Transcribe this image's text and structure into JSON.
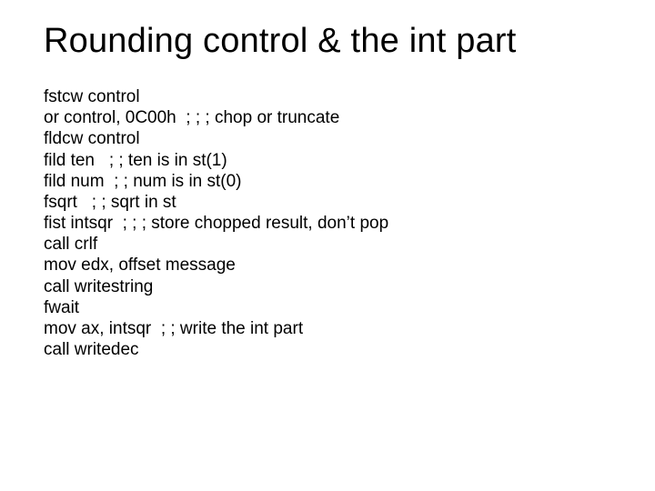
{
  "title": "Rounding control & the int part",
  "code_lines": [
    "fstcw control",
    "or control, 0C00h  ; ; ; chop or truncate",
    "fldcw control",
    "fild ten   ; ; ten is in st(1)",
    "fild num  ; ; num is in st(0)",
    "fsqrt   ; ; sqrt in st",
    "fist intsqr  ; ; ; store chopped result, don’t pop",
    "call crlf",
    "mov edx, offset message",
    "call writestring",
    "fwait",
    "mov ax, intsqr  ; ; write the int part",
    "call writedec"
  ]
}
